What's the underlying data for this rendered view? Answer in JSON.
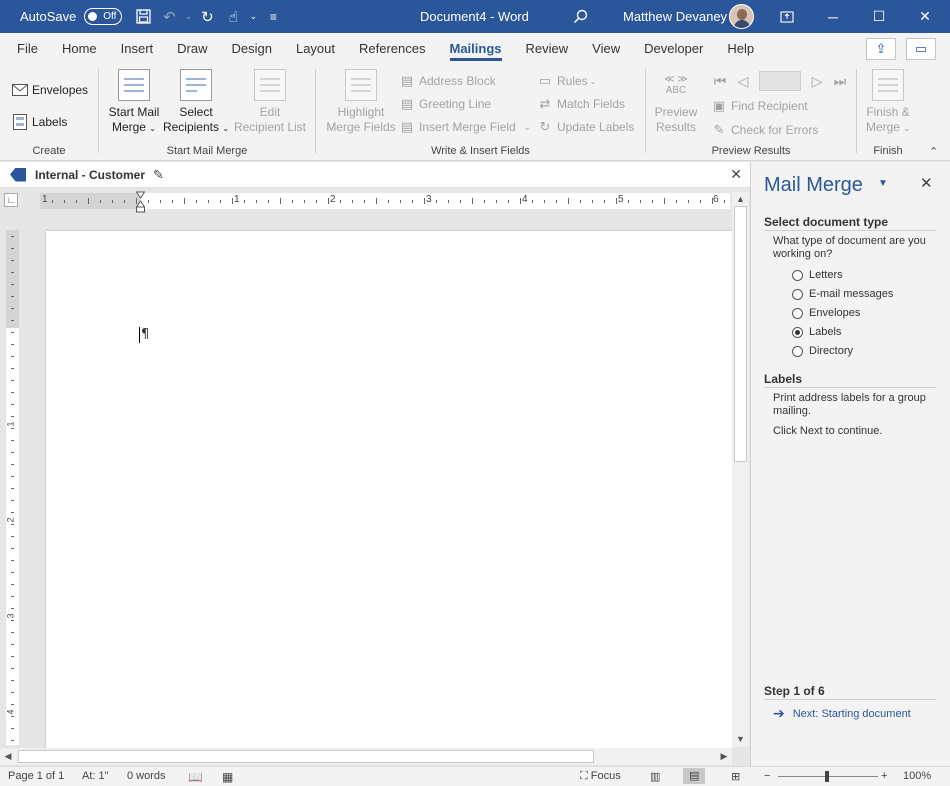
{
  "titlebar": {
    "autosave_label": "AutoSave",
    "autosave_state": "Off",
    "document_title": "Document4  -  Word",
    "user_name": "Matthew Devaney"
  },
  "tabs": [
    "File",
    "Home",
    "Insert",
    "Draw",
    "Design",
    "Layout",
    "References",
    "Mailings",
    "Review",
    "View",
    "Developer",
    "Help"
  ],
  "active_tab": "Mailings",
  "ribbon": {
    "create": {
      "envelopes": "Envelopes",
      "labels": "Labels",
      "group_label": "Create"
    },
    "start_mail_merge": {
      "start_mail_merge_l1": "Start Mail",
      "start_mail_merge_l2": "Merge",
      "select_recipients_l1": "Select",
      "select_recipients_l2": "Recipients",
      "edit_recipient_list_l1": "Edit",
      "edit_recipient_list_l2": "Recipient List",
      "group_label": "Start Mail Merge"
    },
    "write_insert": {
      "highlight_l1": "Highlight",
      "highlight_l2": "Merge Fields",
      "address_block": "Address Block",
      "greeting_line": "Greeting Line",
      "insert_merge_field": "Insert Merge Field",
      "rules": "Rules",
      "match_fields": "Match Fields",
      "update_labels": "Update Labels",
      "group_label": "Write & Insert Fields"
    },
    "preview": {
      "preview_icon_text": "ABC",
      "preview_results_l1": "Preview",
      "preview_results_l2": "Results",
      "find_recipient": "Find Recipient",
      "check_for_errors": "Check for Errors",
      "group_label": "Preview Results"
    },
    "finish": {
      "finish_l1": "Finish &",
      "finish_l2": "Merge",
      "group_label": "Finish"
    }
  },
  "sensitivity": {
    "label": "Internal - Customer"
  },
  "ruler": {
    "h_numbers": [
      "1",
      "1",
      "2",
      "3",
      "4",
      "5",
      "6"
    ],
    "v_numbers": [
      "1",
      "2",
      "3",
      "4"
    ]
  },
  "document": {
    "paragraph_mark": "¶"
  },
  "pane": {
    "title": "Mail Merge",
    "section1_heading": "Select document type",
    "question": "What type of document are you working on?",
    "options": [
      "Letters",
      "E-mail messages",
      "Envelopes",
      "Labels",
      "Directory"
    ],
    "selected_option": "Labels",
    "section2_heading": "Labels",
    "description": "Print address labels for a group mailing.",
    "instruction": "Click Next to continue.",
    "step": "Step 1 of 6",
    "next_link": "Next: Starting document"
  },
  "statusbar": {
    "page": "Page 1 of 1",
    "position": "At: 1\"",
    "words": "0 words",
    "focus": "Focus",
    "zoom": "100%"
  },
  "icons": {
    "save": "save-icon",
    "undo": "undo-icon",
    "redo": "redo-icon",
    "touch": "touch-mode-icon",
    "search": "search-icon",
    "tag": "sensitivity-tag-icon"
  },
  "colors": {
    "accent": "#2b579a",
    "ribbon_bg": "#f3f3f3",
    "disabled_text": "#a3a3a3"
  }
}
